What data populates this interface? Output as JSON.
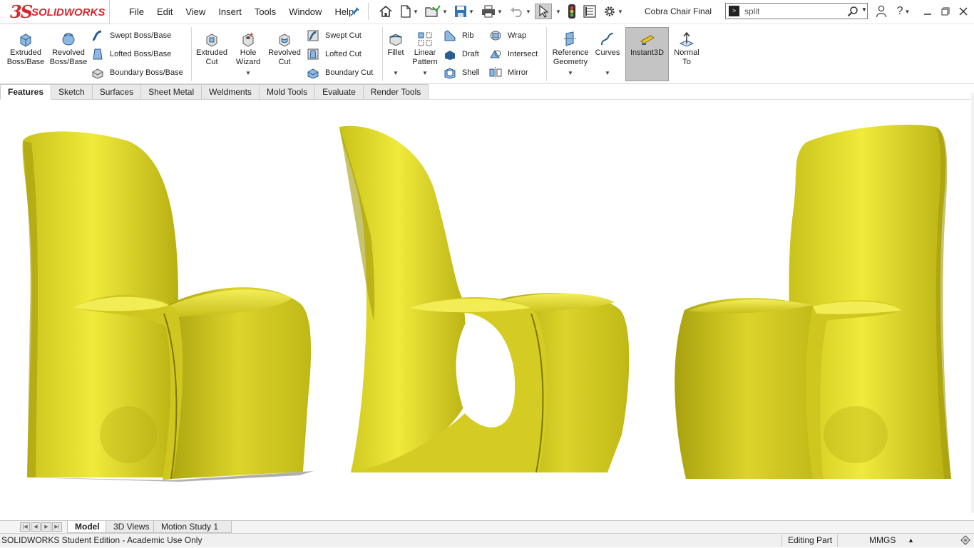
{
  "app": {
    "logo_ds": "3S",
    "logo_text": "SOLIDWORKS",
    "document_title": "Cobra Chair Final"
  },
  "menu": [
    "File",
    "Edit",
    "View",
    "Insert",
    "Tools",
    "Window",
    "Help"
  ],
  "search": {
    "value": "split",
    "placeholder": ""
  },
  "ribbon": {
    "extruded_boss": [
      "Extruded",
      "Boss/Base"
    ],
    "revolved_boss": [
      "Revolved",
      "Boss/Base"
    ],
    "swept_boss": "Swept Boss/Base",
    "lofted_boss": "Lofted Boss/Base",
    "boundary_boss": "Boundary Boss/Base",
    "extruded_cut": [
      "Extruded",
      "Cut"
    ],
    "hole_wizard": [
      "Hole",
      "Wizard"
    ],
    "revolved_cut": [
      "Revolved",
      "Cut"
    ],
    "swept_cut": "Swept Cut",
    "lofted_cut": "Lofted Cut",
    "boundary_cut": "Boundary Cut",
    "fillet": "Fillet",
    "linear_pattern": [
      "Linear",
      "Pattern"
    ],
    "rib": "Rib",
    "draft": "Draft",
    "shell": "Shell",
    "wrap": "Wrap",
    "intersect": "Intersect",
    "mirror": "Mirror",
    "reference_geometry": [
      "Reference",
      "Geometry"
    ],
    "curves": "Curves",
    "instant3d": "Instant3D",
    "normal_to": [
      "Normal",
      "To"
    ]
  },
  "tabs": [
    "Features",
    "Sketch",
    "Surfaces",
    "Sheet Metal",
    "Weldments",
    "Mold Tools",
    "Evaluate",
    "Render Tools"
  ],
  "bottom_tabs": [
    "Model",
    "3D Views",
    "Motion Study 1"
  ],
  "status": {
    "edition": "SOLIDWORKS Student Edition - Academic Use Only",
    "mode": "Editing Part",
    "units": "MMGS"
  },
  "colors": {
    "brand": "#d9262e",
    "chair": "#e6e030",
    "chair_dark": "#8f8a10",
    "accent_icon": "#2e75b6"
  }
}
